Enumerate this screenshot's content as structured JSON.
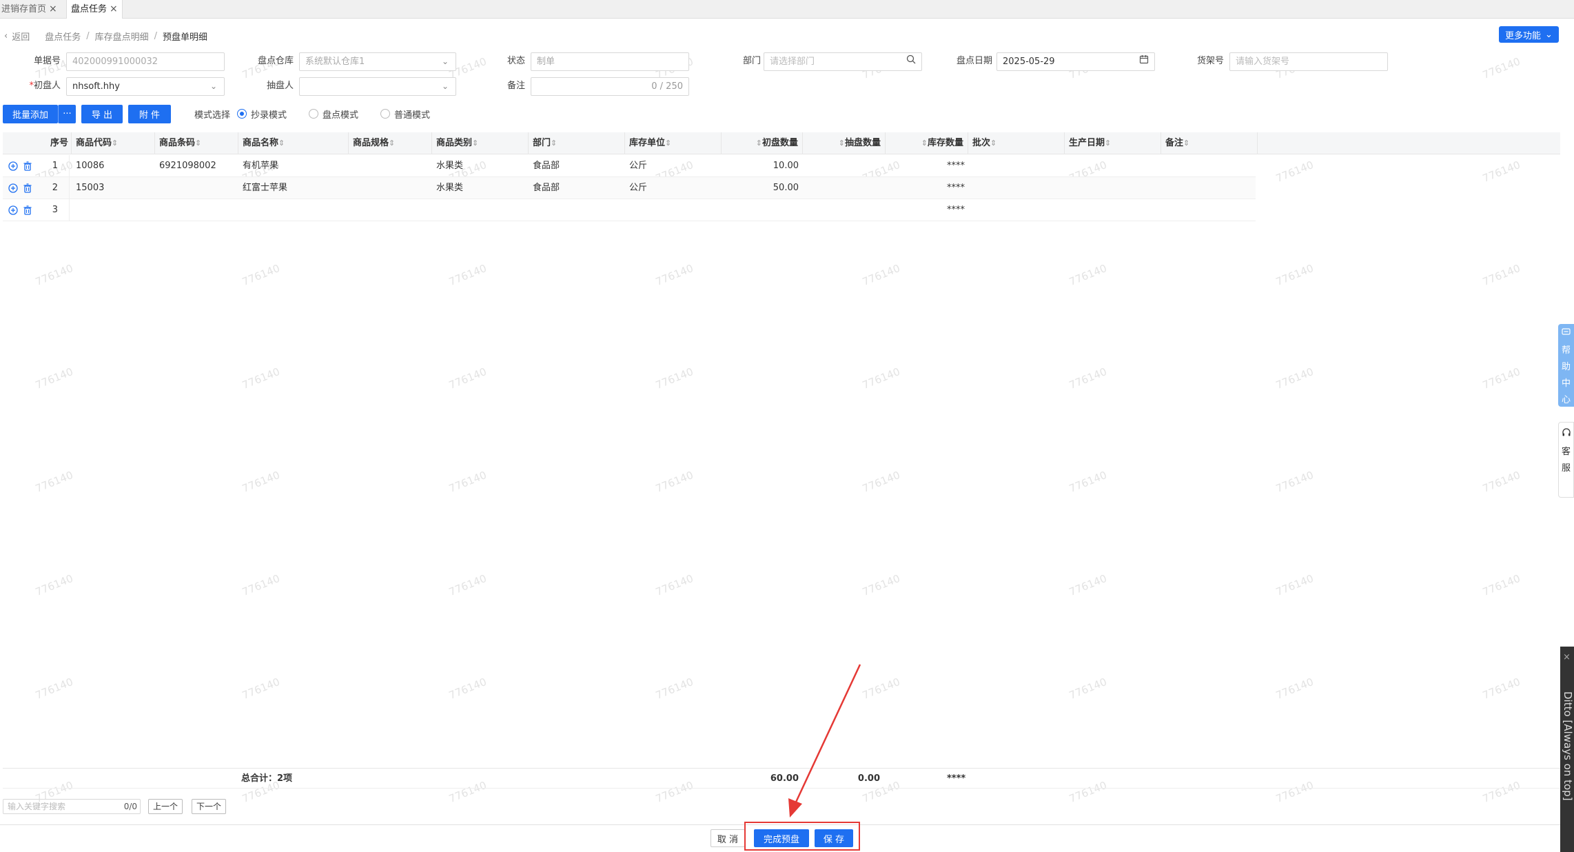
{
  "tabs": [
    {
      "label": "进销存首页",
      "active": false
    },
    {
      "label": "盘点任务",
      "active": true
    }
  ],
  "breadcrumb": {
    "back": "返回",
    "items": [
      "盘点任务",
      "库存盘点明细",
      "预盘单明细"
    ]
  },
  "more_button": "更多功能",
  "form": {
    "doc_no": {
      "label": "单据号",
      "value": "402000991000032"
    },
    "warehouse": {
      "label": "盘点仓库",
      "value": "系统默认仓库1"
    },
    "status": {
      "label": "状态",
      "value": "制单"
    },
    "department": {
      "label": "部门",
      "placeholder": "请选择部门"
    },
    "count_date": {
      "label": "盘点日期",
      "value": "2025-05-29"
    },
    "shelf_no": {
      "label": "货架号",
      "placeholder": "请输入货架号"
    },
    "first_counter": {
      "label": "初盘人",
      "required_mark": "*",
      "value": "nhsoft.hhy"
    },
    "sampler": {
      "label": "抽盘人",
      "value": ""
    },
    "remark": {
      "label": "备注",
      "count": "0 / 250"
    }
  },
  "toolbar": {
    "batch_add": "批量添加",
    "more_dots": "···",
    "export": "导 出",
    "attachment": "附 件",
    "mode_label": "模式选择",
    "modes": [
      {
        "label": "抄录模式",
        "selected": true
      },
      {
        "label": "盘点模式",
        "selected": false
      },
      {
        "label": "普通模式",
        "selected": false
      }
    ]
  },
  "table": {
    "columns": [
      "序号",
      "商品代码",
      "商品条码",
      "商品名称",
      "商品规格",
      "商品类别",
      "部门",
      "库存单位",
      "初盘数量",
      "抽盘数量",
      "库存数量",
      "批次",
      "生产日期",
      "备注"
    ],
    "rows": [
      {
        "seq": "1",
        "code": "10086",
        "barcode": "6921098002",
        "name": "有机苹果",
        "spec": "",
        "category": "水果类",
        "dept": "食品部",
        "unit": "公斤",
        "first_qty": "10.00",
        "sample_qty": "",
        "stock_qty": "****"
      },
      {
        "seq": "2",
        "code": "15003",
        "barcode": "",
        "name": "红富士苹果",
        "spec": "",
        "category": "水果类",
        "dept": "食品部",
        "unit": "公斤",
        "first_qty": "50.00",
        "sample_qty": "",
        "stock_qty": "****"
      },
      {
        "seq": "3",
        "code": "",
        "barcode": "",
        "name": "",
        "spec": "",
        "category": "",
        "dept": "",
        "unit": "",
        "first_qty": "",
        "sample_qty": "",
        "stock_qty": "****"
      }
    ],
    "totals": {
      "label": "总合计：2项",
      "first_qty": "60.00",
      "sample_qty": "0.00",
      "stock_qty": "****"
    }
  },
  "search": {
    "placeholder": "输入关键字搜索",
    "count": "0/0",
    "prev": "上一个",
    "next": "下一个"
  },
  "actions": {
    "cancel": "取 消",
    "finish": "完成预盘",
    "save": "保 存"
  },
  "side": {
    "help": [
      "帮",
      "助",
      "中",
      "心"
    ],
    "service": [
      "客",
      "服"
    ],
    "ditto": "Ditto [Always on top]"
  },
  "watermark": "776140",
  "colors": {
    "primary": "#1e6ff1",
    "highlight": "#e53935"
  }
}
